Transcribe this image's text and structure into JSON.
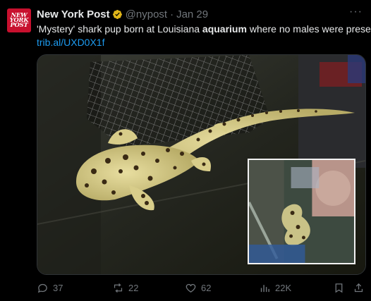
{
  "account": {
    "avatar_text": "NEW YORK POST",
    "name": "New York Post",
    "handle": "@nypost",
    "date": "Jan 29",
    "verified": true
  },
  "tweet": {
    "text_before": "'Mystery' shark pup born at Louisiana ",
    "text_bold": "aquarium",
    "text_after": " where no males were present",
    "link": "trib.al/UXD0X1f"
  },
  "media": {
    "description_icon": "shark-pup-photo"
  },
  "actions": {
    "replies": "37",
    "reposts": "22",
    "likes": "62",
    "views": "22K"
  },
  "colors": {
    "background": "#000000",
    "text": "#e7e9ea",
    "muted": "#71767b",
    "link": "#1d9bf0",
    "brand": "#c8102e"
  }
}
